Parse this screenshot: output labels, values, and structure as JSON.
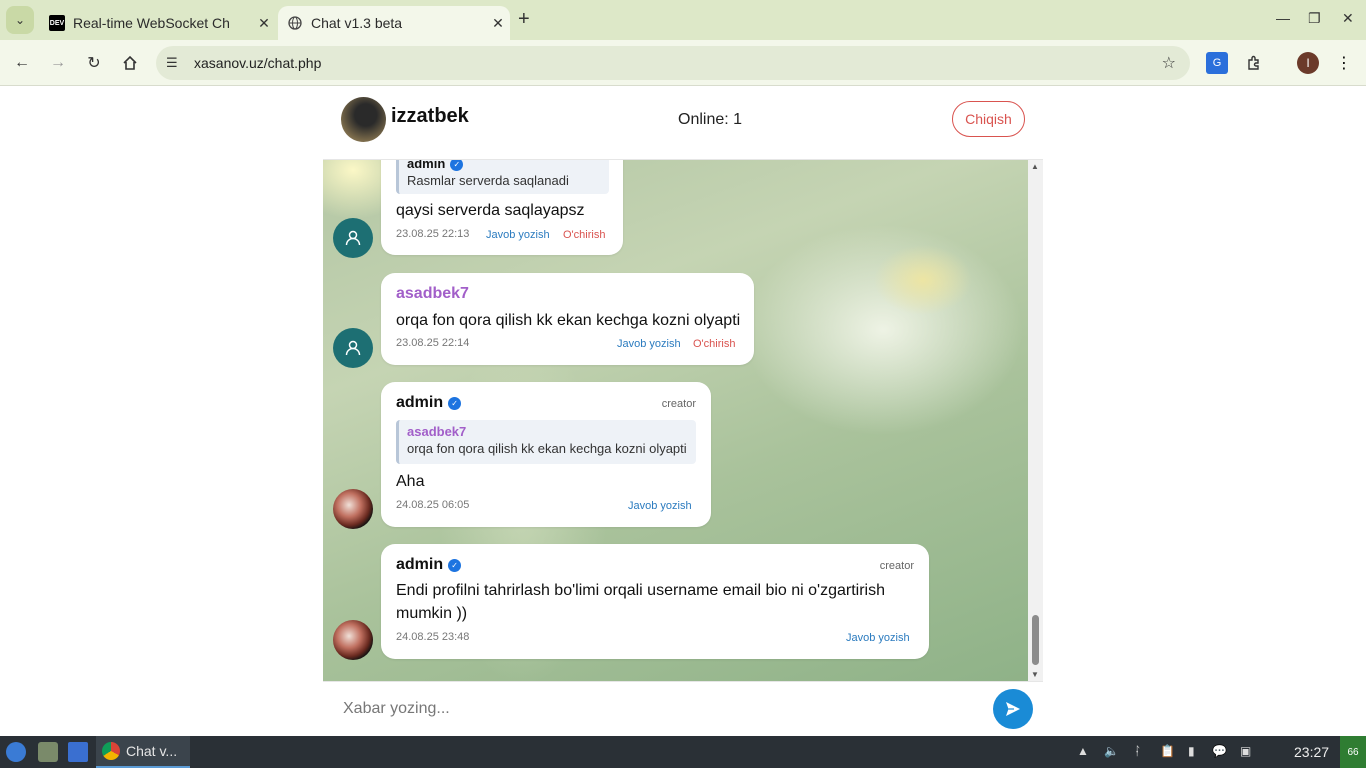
{
  "browser": {
    "tabs": [
      {
        "label": "Real-time WebSocket Ch",
        "favicon": "DEV"
      },
      {
        "label": "Chat v1.3 beta"
      }
    ],
    "url": "xasanov.uz/chat.php"
  },
  "chat": {
    "username": "izzatbek",
    "online": "Online: 1",
    "logout_label": "Chiqish",
    "composer_placeholder": "Xabar yozing...",
    "messages": [
      {
        "reply_name": "admin",
        "reply_text": "Rasmlar serverda saqlanadi",
        "text": "qaysi serverda saqlayapsz",
        "time": "23.08.25 22:13",
        "reply_label": "Javob yozish",
        "delete_label": "O'chirish"
      },
      {
        "sender": "asadbek7",
        "text": "orqa fon qora qilish kk ekan kechga kozni olyapti",
        "time": "23.08.25 22:14",
        "reply_label": "Javob yozish",
        "delete_label": "O'chirish"
      },
      {
        "sender": "admin",
        "role": "creator",
        "reply_name": "asadbek7",
        "reply_text": "orqa fon qora qilish kk ekan kechga kozni olyapti",
        "text": "Aha",
        "time": "24.08.25 06:05",
        "reply_label": "Javob yozish"
      },
      {
        "sender": "admin",
        "role": "creator",
        "text_line1": "Endi profilni tahrirlash bo'limi orqali username email bio ni o'zgartirish",
        "text_line2": "mumkin ))",
        "time": "24.08.25 23:48",
        "reply_label": "Javob yozish"
      }
    ]
  },
  "taskbar": {
    "app_label": "Chat v...",
    "clock": "23:27",
    "battery": "66"
  },
  "colors": {
    "accent": "#1a8bd6",
    "danger": "#d9534f",
    "user_name": "#a25fc9",
    "verified": "#1d74e0"
  }
}
